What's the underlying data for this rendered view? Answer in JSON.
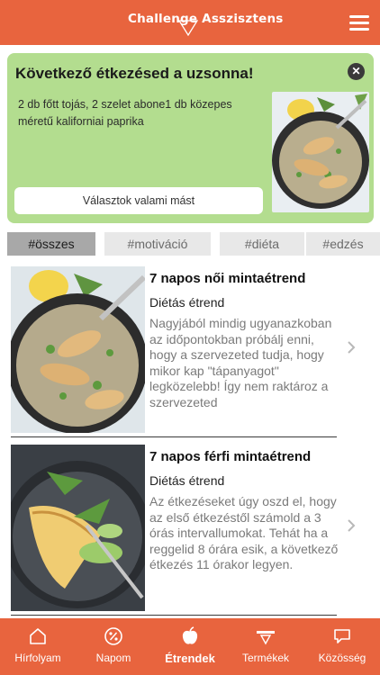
{
  "header": {
    "logo_text": "Challenge Asszisztens",
    "menu_icon": "hamburger-menu-icon"
  },
  "meal_card": {
    "title": "Következő étkezésed a uzsonna!",
    "description": "2 db főtt tojás, 2 szelet abone1 db közepes méretű kaliforniai paprika",
    "choose_label": "Választok valami mást",
    "close_icon": "close-icon"
  },
  "tags": [
    {
      "label": "#összes",
      "active": true
    },
    {
      "label": "#motiváció",
      "active": false
    },
    {
      "label": "#diéta",
      "active": false
    },
    {
      "label": "#edzés",
      "active": false
    }
  ],
  "articles": [
    {
      "title": "7 napos női mintaétrend",
      "subtitle": "Diétás étrend",
      "excerpt": "Nagyjából mindig ugyanazkoban az időpontokban próbálj enni, hogy a szervezeted tudja, hogy mikor kap \"tápanyagot\" legközelebb! Így nem raktároz a szervezeted"
    },
    {
      "title": "7 napos férfi mintaétrend",
      "subtitle": "Diétás étrend",
      "excerpt": "Az étkezéseket úgy oszd el, hogy az első étkezéstől számold a 3 órás intervallumokat. Tehát ha a reggelid 8 órára esik, a következő étkezés 11 órakor legyen."
    }
  ],
  "bottom_nav": [
    {
      "label": "Hírfolyam",
      "icon": "home-icon",
      "active": false
    },
    {
      "label": "Napom",
      "icon": "percent-icon",
      "active": false
    },
    {
      "label": "Étrendek",
      "icon": "apple-icon",
      "active": true
    },
    {
      "label": "Termékek",
      "icon": "challenge-logo-icon",
      "active": false
    },
    {
      "label": "Közösség",
      "icon": "chat-bubble-icon",
      "active": false
    }
  ],
  "colors": {
    "brand": "#e8643e",
    "card_green": "#b3dd8f",
    "tag_active": "#a8a8a8",
    "tag_inactive": "#e8e8e8"
  }
}
